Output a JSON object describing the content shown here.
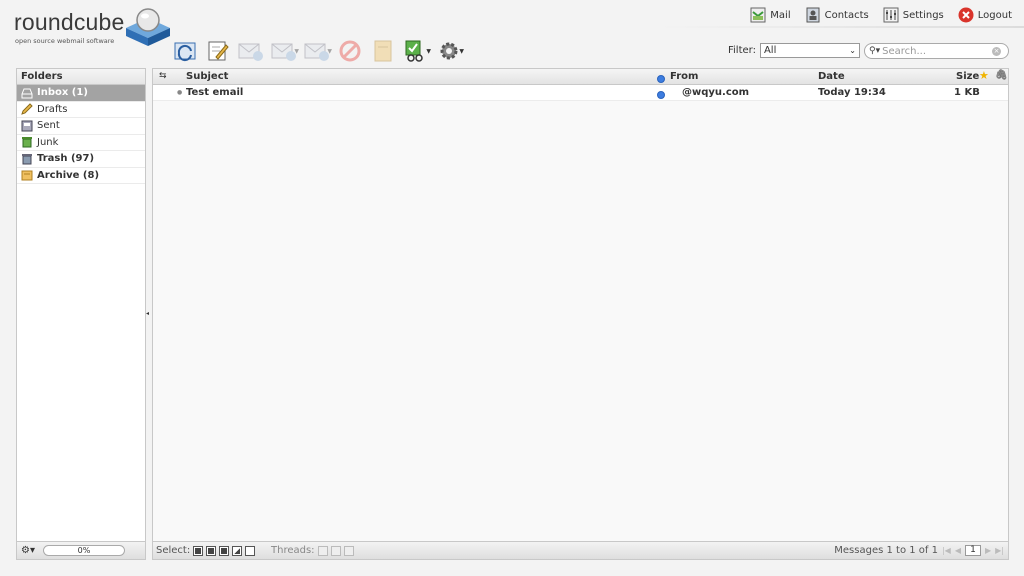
{
  "app": {
    "logo_text": "roundcube",
    "tagline": "open source webmail software"
  },
  "topnav": [
    {
      "label": "Mail",
      "icon": "mail-icon"
    },
    {
      "label": "Contacts",
      "icon": "contacts-icon"
    },
    {
      "label": "Settings",
      "icon": "settings-icon"
    },
    {
      "label": "Logout",
      "icon": "logout-icon"
    }
  ],
  "toolbar": {
    "buttons": [
      {
        "name": "check-mail",
        "icon": "refresh-mail-icon",
        "enabled": true
      },
      {
        "name": "compose",
        "icon": "compose-icon",
        "enabled": true
      },
      {
        "name": "reply",
        "icon": "reply-icon",
        "enabled": false
      },
      {
        "name": "reply-all",
        "icon": "reply-all-icon",
        "enabled": false
      },
      {
        "name": "forward",
        "icon": "forward-icon",
        "enabled": false
      },
      {
        "name": "delete",
        "icon": "delete-icon",
        "enabled": false
      },
      {
        "name": "archive",
        "icon": "archive-icon",
        "enabled": false
      },
      {
        "name": "mark",
        "icon": "mark-icon",
        "enabled": true
      },
      {
        "name": "more",
        "icon": "gear-icon",
        "enabled": true
      }
    ]
  },
  "filter": {
    "label": "Filter:",
    "selected": "All"
  },
  "search": {
    "placeholder": "Search..."
  },
  "folders": {
    "title": "Folders",
    "items": [
      {
        "label": "Inbox (1)",
        "icon": "inbox-icon",
        "selected": true,
        "bold": true
      },
      {
        "label": "Drafts",
        "icon": "drafts-icon",
        "selected": false,
        "bold": false
      },
      {
        "label": "Sent",
        "icon": "sent-icon",
        "selected": false,
        "bold": false
      },
      {
        "label": "Junk",
        "icon": "junk-icon",
        "selected": false,
        "bold": false
      },
      {
        "label": "Trash (97)",
        "icon": "trash-icon",
        "selected": false,
        "bold": true
      },
      {
        "label": "Archive (8)",
        "icon": "archive-folder-icon",
        "selected": false,
        "bold": true
      }
    ],
    "quota": "0%"
  },
  "messages": {
    "columns": {
      "subject": "Subject",
      "from": "From",
      "date": "Date",
      "size": "Size"
    },
    "rows": [
      {
        "subject": "Test email",
        "from": "@wqyu.com",
        "date": "Today 19:34",
        "size": "1 KB",
        "unread": true
      }
    ],
    "footer": {
      "select_label": "Select:",
      "threads_label": "Threads:",
      "count_text": "Messages 1 to 1 of 1",
      "page": "1"
    }
  },
  "colors": {
    "selected_folder": "#a3a3a3",
    "unread_dot": "#3d7de0",
    "logout_red": "#d9342b"
  }
}
